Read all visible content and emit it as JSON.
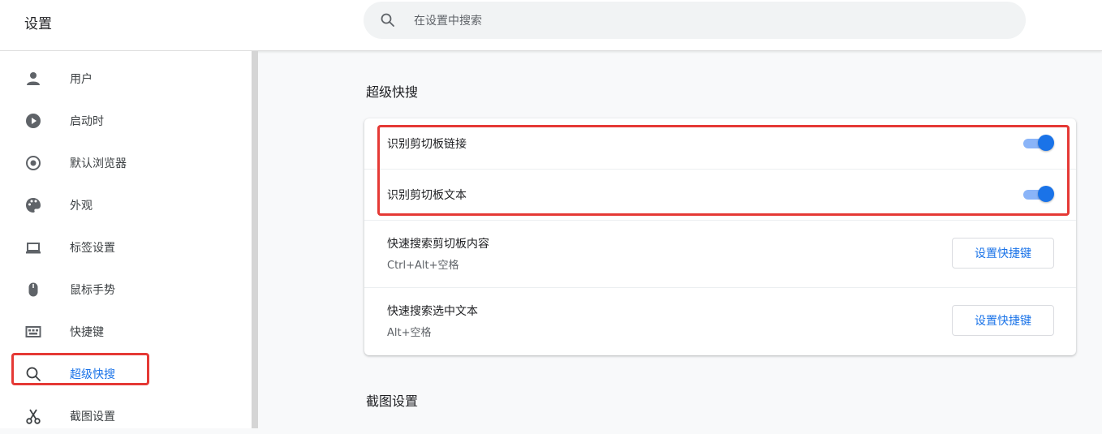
{
  "header": {
    "title": "设置",
    "search_placeholder": "在设置中搜索"
  },
  "sidebar": {
    "items": [
      {
        "label": "用户",
        "icon": "person-icon"
      },
      {
        "label": "启动时",
        "icon": "power-icon"
      },
      {
        "label": "默认浏览器",
        "icon": "browser-icon"
      },
      {
        "label": "外观",
        "icon": "palette-icon"
      },
      {
        "label": "标签设置",
        "icon": "laptop-icon"
      },
      {
        "label": "鼠标手势",
        "icon": "mouse-icon"
      },
      {
        "label": "快捷键",
        "icon": "keyboard-icon"
      },
      {
        "label": "超级快搜",
        "icon": "search-icon",
        "active": true
      },
      {
        "label": "截图设置",
        "icon": "scissors-icon"
      }
    ]
  },
  "main": {
    "section_title": "超级快搜",
    "rows": [
      {
        "label": "识别剪切板链接",
        "toggle_on": true
      },
      {
        "label": "识别剪切板文本",
        "toggle_on": true
      },
      {
        "label": "快速搜索剪切板内容",
        "sublabel": "Ctrl+Alt+空格",
        "button": "设置快捷键"
      },
      {
        "label": "快速搜索选中文本",
        "sublabel": "Alt+空格",
        "button": "设置快捷键"
      }
    ],
    "next_section_title": "截图设置"
  },
  "colors": {
    "accent": "#1a73e8",
    "toggle_track": "#8ab4f8",
    "highlight": "#e53935"
  }
}
